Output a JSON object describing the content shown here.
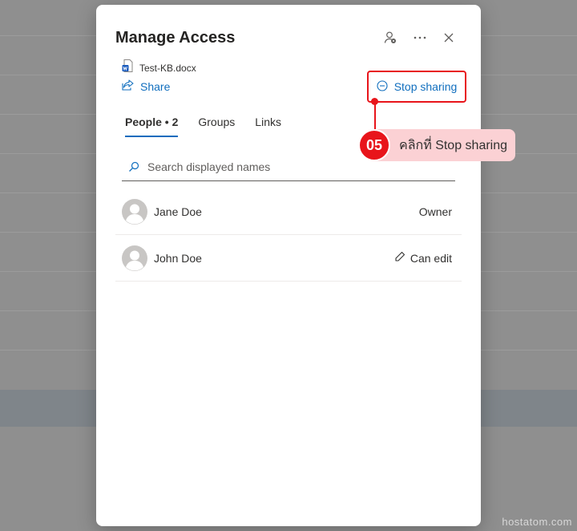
{
  "dialog": {
    "title": "Manage Access",
    "file_name": "Test-KB.docx",
    "share_label": "Share",
    "stop_sharing_label": "Stop sharing",
    "tabs": [
      {
        "label": "People • 2",
        "active": true
      },
      {
        "label": "Groups",
        "active": false
      },
      {
        "label": "Links",
        "active": false
      }
    ],
    "search": {
      "placeholder": "Search displayed names",
      "value": ""
    },
    "people": [
      {
        "name": "Jane Doe",
        "role": "Owner"
      },
      {
        "name": "John Doe",
        "role": "Can edit"
      }
    ]
  },
  "annotation": {
    "step": "05",
    "text": "คลิกที่ Stop sharing"
  },
  "watermark": "hostatom.com",
  "colors": {
    "accent": "#106ebe",
    "highlight": "#e8151b",
    "callout_bg": "#fbd1d4"
  }
}
